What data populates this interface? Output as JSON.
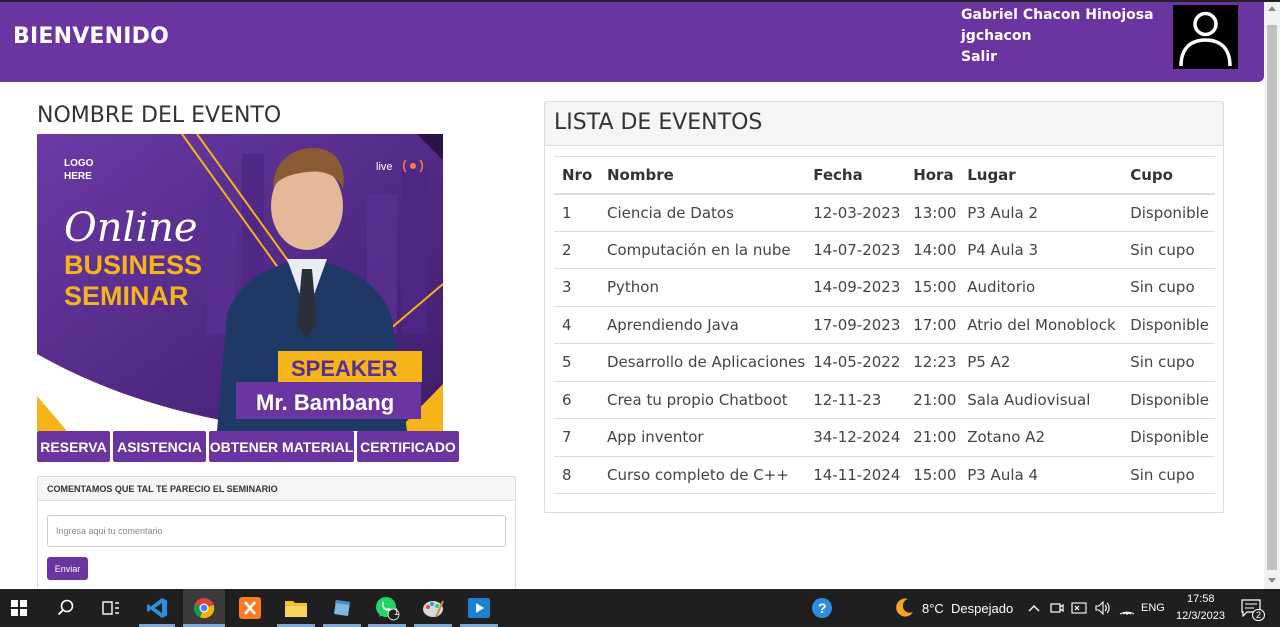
{
  "header": {
    "title": "BIENVENIDO",
    "user_name": "Gabriel Chacon Hinojosa",
    "username": "jgchacon",
    "logout": "Salir"
  },
  "event": {
    "title": "NOMBRE DEL EVENTO",
    "poster": {
      "logo": "LOGO HERE",
      "live": "live",
      "line1": "Online",
      "line2": "BUSINESS",
      "line3": "SEMINAR",
      "speaker_label": "SPEAKER",
      "speaker_name": "Mr. Bambang"
    },
    "buttons": [
      "RESERVA",
      "ASISTENCIA",
      "OBTENER MATERIAL",
      "CERTIFICADO"
    ]
  },
  "comments": {
    "title": "COMENTAMOS QUE TAL TE PARECIO EL SEMINARIO",
    "placeholder": "Ingresa aqui tu comentario",
    "send": "Enviar"
  },
  "events_list": {
    "title": "LISTA DE EVENTOS",
    "columns": [
      "Nro",
      "Nombre",
      "Fecha",
      "Hora",
      "Lugar",
      "Cupo"
    ],
    "rows": [
      [
        "1",
        "Ciencia de Datos",
        "12-03-2023",
        "13:00",
        "P3 Aula 2",
        "Disponible"
      ],
      [
        "2",
        "Computación en la nube",
        "14-07-2023",
        "14:00",
        "P4 Aula 3",
        "Sin cupo"
      ],
      [
        "3",
        "Python",
        "14-09-2023",
        "15:00",
        "Auditorio",
        "Sin cupo"
      ],
      [
        "4",
        "Aprendiendo Java",
        "17-09-2023",
        "17:00",
        "Atrio del Monoblock",
        "Disponible"
      ],
      [
        "5",
        "Desarrollo de Aplicaciones",
        "14-05-2022",
        "12:23",
        "P5 A2",
        "Sin cupo"
      ],
      [
        "6",
        "Crea tu propio Chatboot",
        "12-11-23",
        "21:00",
        "Sala Audiovisual",
        "Disponible"
      ],
      [
        "7",
        "App inventor",
        "34-12-2024",
        "21:00",
        "Zotano A2",
        "Disponible"
      ],
      [
        "8",
        "Curso completo de C++",
        "14-11-2024",
        "15:00",
        "P3 Aula 4",
        "Sin cupo"
      ]
    ]
  },
  "taskbar": {
    "weather": "8°C  Despejado",
    "language": "ENG",
    "time": "17:58",
    "date": "12/3/2023",
    "whatsapp_badge": "1",
    "notification_badge": "2"
  },
  "colors": {
    "primary": "#6a35a1",
    "accent_yellow": "#f5b418"
  }
}
